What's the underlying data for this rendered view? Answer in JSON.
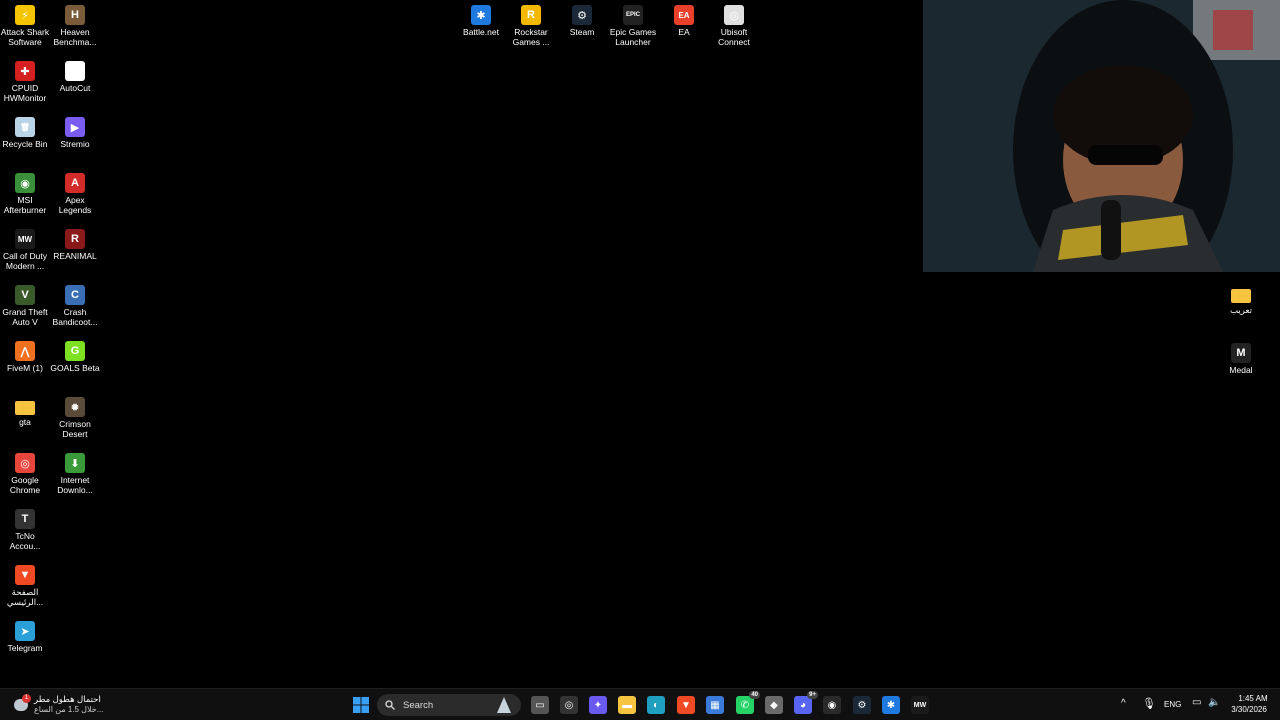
{
  "desktop_left": [
    {
      "label": "Attack Shark\nSoftware",
      "icon": "attack-shark-icon",
      "color": "#f5c400",
      "glyph": "⚡"
    },
    {
      "label": "Heaven\nBenchma...",
      "icon": "heaven-benchmark-icon",
      "color": "#7a5c3a",
      "glyph": "H"
    },
    {
      "label": "CPUID\nHWMonitor",
      "icon": "hwmonitor-icon",
      "color": "#d42020",
      "glyph": "✚"
    },
    {
      "label": "AutoCut",
      "icon": "autocut-icon",
      "color": "#ffffff",
      "glyph": "✂"
    },
    {
      "label": "Recycle Bin",
      "icon": "recycle-bin-icon",
      "color": "#b8d4e6",
      "glyph": "🗑"
    },
    {
      "label": "Stremio",
      "icon": "stremio-icon",
      "color": "#7b5cf0",
      "glyph": "▶"
    },
    {
      "label": "MSI\nAfterburner",
      "icon": "msi-afterburner-icon",
      "color": "#3a8f3a",
      "glyph": "◉"
    },
    {
      "label": "Apex\nLegends",
      "icon": "apex-legends-icon",
      "color": "#d32a2a",
      "glyph": "A"
    },
    {
      "label": "Call of Duty\nModern ...",
      "icon": "call-of-duty-icon",
      "color": "#1a1a1a",
      "glyph": "MW"
    },
    {
      "label": "REANIMAL",
      "icon": "reanimal-icon",
      "color": "#8a1a1a",
      "glyph": "R"
    },
    {
      "label": "Grand Theft\nAuto V",
      "icon": "gta-v-icon",
      "color": "#3a5a2a",
      "glyph": "V"
    },
    {
      "label": "Crash\nBandicoot...",
      "icon": "crash-bandicoot-icon",
      "color": "#3a6fb5",
      "glyph": "C"
    },
    {
      "label": "FiveM (1)",
      "icon": "fivem-icon",
      "color": "#f07020",
      "glyph": "⋀"
    },
    {
      "label": "GOALS Beta",
      "icon": "goals-beta-icon",
      "color": "#7de020",
      "glyph": "G"
    },
    {
      "label": "gta",
      "icon": "folder-icon",
      "color": "#f5c542",
      "glyph": ""
    },
    {
      "label": "Crimson\nDesert",
      "icon": "crimson-desert-icon",
      "color": "#5a4a3a",
      "glyph": "✹"
    },
    {
      "label": "Google\nChrome",
      "icon": "chrome-icon",
      "color": "#e8453c",
      "glyph": "◎"
    },
    {
      "label": "Internet\nDownlo...",
      "icon": "internet-download-manager-icon",
      "color": "#3a9a3a",
      "glyph": "⬇"
    },
    {
      "label": "TcNo\nAccou...",
      "icon": "tcno-account-icon",
      "color": "#333333",
      "glyph": "T"
    },
    {
      "label": "الصفحة\nالرئيسي...",
      "icon": "brave-icon",
      "color": "#f04a24",
      "glyph": "▼"
    },
    {
      "label": "Telegram",
      "icon": "telegram-icon",
      "color": "#2a9fd8",
      "glyph": "➤"
    }
  ],
  "desktop_top": [
    {
      "label": "Battle.net",
      "icon": "battlenet-icon",
      "color": "#1f7ae0",
      "glyph": "✱"
    },
    {
      "label": "Rockstar\nGames ...",
      "icon": "rockstar-icon",
      "color": "#f5b800",
      "glyph": "R"
    },
    {
      "label": "Steam",
      "icon": "steam-icon",
      "color": "#1b2838",
      "glyph": "⚙"
    },
    {
      "label": "Epic Games\nLauncher",
      "icon": "epic-games-icon",
      "color": "#222222",
      "glyph": "EPIC"
    },
    {
      "label": "EA",
      "icon": "ea-icon",
      "color": "#e8402a",
      "glyph": "EA"
    },
    {
      "label": "Ubisoft\nConnect",
      "icon": "ubisoft-icon",
      "color": "#e0e0e0",
      "glyph": "◎"
    }
  ],
  "desktop_right": [
    {
      "label": "تعريب",
      "icon": "folder-icon",
      "color": "#f5c542",
      "glyph": ""
    },
    {
      "label": "Medal",
      "icon": "medal-icon",
      "color": "#222222",
      "glyph": "M"
    }
  ],
  "taskbar": {
    "weather_line1": "احتمال هطول مطر",
    "weather_line2": "خلال 1.5 من الساع...",
    "weather_badge": "1",
    "search_placeholder": "Search",
    "apps": [
      {
        "icon": "task-view-icon",
        "color": "#555555",
        "glyph": "▭"
      },
      {
        "icon": "tcno-taskbar-icon",
        "color": "#333333",
        "glyph": "◎"
      },
      {
        "icon": "copilot-icon",
        "color": "#6a5af0",
        "glyph": "✦"
      },
      {
        "icon": "file-explorer-icon",
        "color": "#f5c542",
        "glyph": "▬"
      },
      {
        "icon": "edge-icon",
        "color": "#1fa0c0",
        "glyph": "◐"
      },
      {
        "icon": "brave-taskbar-icon",
        "color": "#f04a24",
        "glyph": "▼"
      },
      {
        "icon": "microsoft-store-icon",
        "color": "#3a7ad8",
        "glyph": "▦"
      },
      {
        "icon": "whatsapp-icon",
        "color": "#25d366",
        "glyph": "✆",
        "badge": "40"
      },
      {
        "icon": "roblox-studio-icon",
        "color": "#6a6a6a",
        "glyph": "◆"
      },
      {
        "icon": "discord-icon",
        "color": "#5865f2",
        "glyph": "◕",
        "badge": "9+"
      },
      {
        "icon": "obs-icon",
        "color": "#2a2a2a",
        "glyph": "◉"
      },
      {
        "icon": "steam-taskbar-icon",
        "color": "#1b2838",
        "glyph": "⚙"
      },
      {
        "icon": "battlenet-taskbar-icon",
        "color": "#1f7ae0",
        "glyph": "✱"
      },
      {
        "icon": "call-of-duty-taskbar-icon",
        "color": "#1a1a1a",
        "glyph": "MW"
      }
    ],
    "tray": {
      "lang": "ENG",
      "time": "1:45 AM",
      "date": "3/30/2026"
    }
  }
}
